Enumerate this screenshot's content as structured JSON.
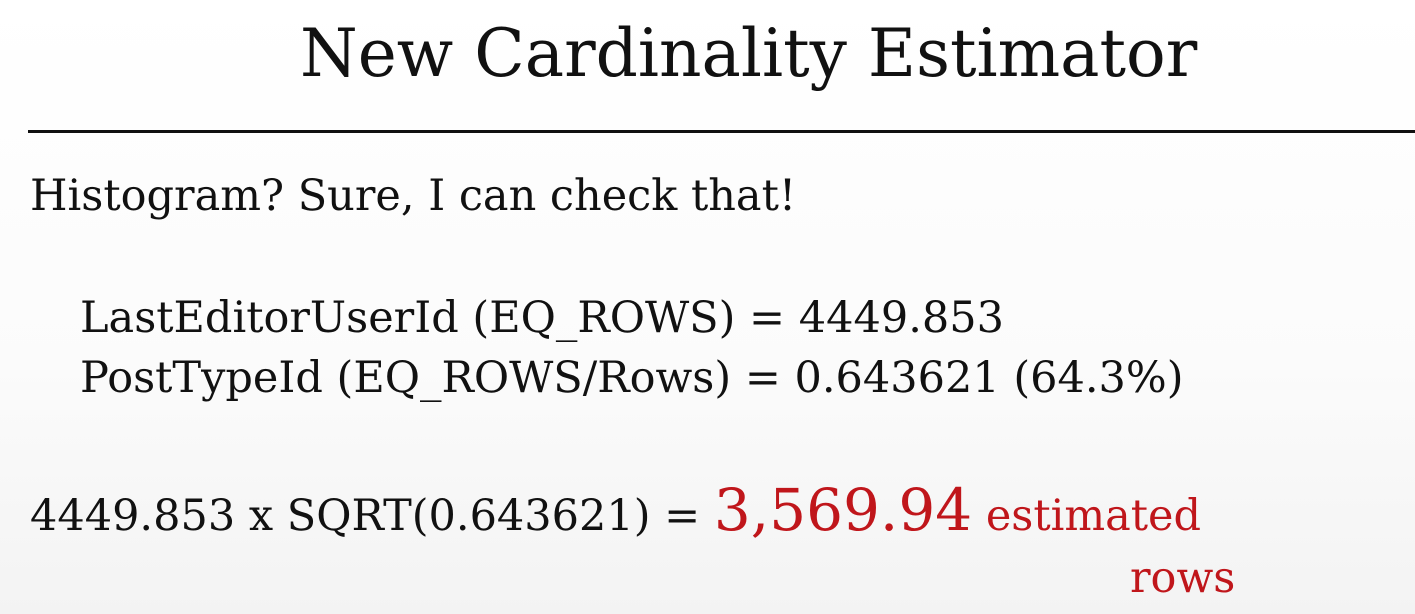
{
  "slide": {
    "title": "New Cardinality Estimator",
    "intro": "Histogram? Sure, I can check that!",
    "equations": [
      "LastEditorUserId (EQ_ROWS) = 4449.853",
      "PostTypeId (EQ_ROWS/Rows) = 0.643621 (64.3%)"
    ],
    "calculation": {
      "expression": "4449.853 x SQRT(0.643621) = ",
      "result": "3,569.94",
      "unit_line1": " estimated",
      "unit_line2": "rows"
    }
  },
  "colors": {
    "text": "#111111",
    "highlight": "#c0161b",
    "background": "#ffffff"
  }
}
